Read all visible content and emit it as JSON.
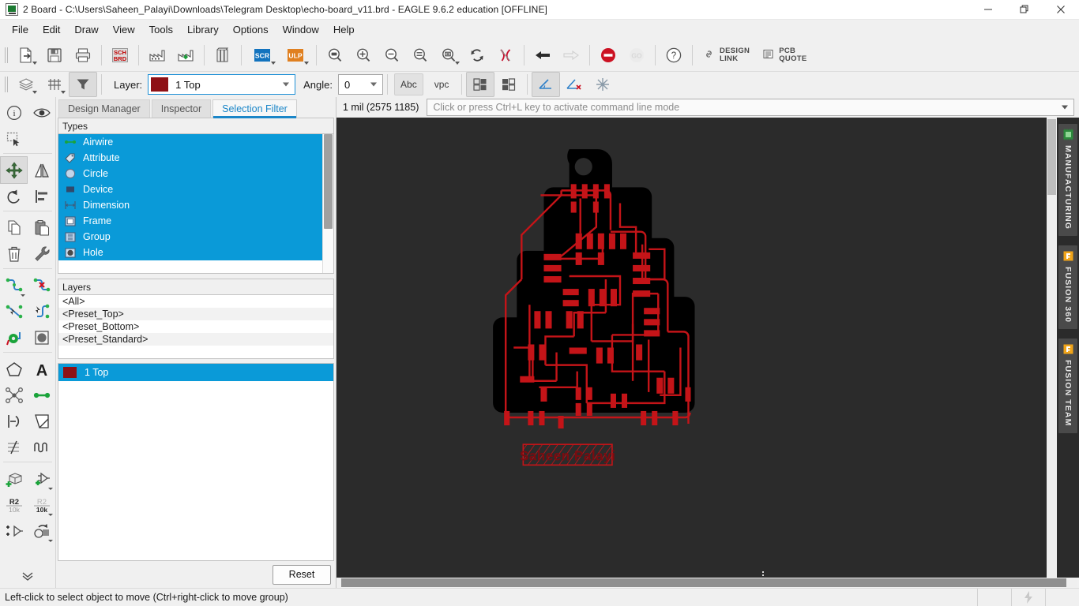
{
  "window": {
    "title": "2 Board - C:\\Users\\Saheen_Palayi\\Downloads\\Telegram Desktop\\echo-board_v11.brd - EAGLE 9.6.2 education [OFFLINE]",
    "app_icon": "board-file-icon",
    "minimize": "minimize-icon",
    "restore": "restore-icon",
    "close": "close-icon"
  },
  "menu": {
    "items": [
      "File",
      "Edit",
      "Draw",
      "View",
      "Tools",
      "Library",
      "Options",
      "Window",
      "Help"
    ]
  },
  "toolbar": {
    "groups": [
      {
        "buttons": [
          {
            "name": "open-file-button",
            "icon": "open-document-icon",
            "dropdown": true,
            "enabled": true
          },
          {
            "name": "save-button",
            "icon": "floppy-save-icon",
            "dropdown": false,
            "enabled": true
          },
          {
            "name": "print-button",
            "icon": "printer-icon",
            "dropdown": false,
            "enabled": true
          }
        ]
      },
      {
        "buttons": [
          {
            "name": "switch-to-schematic-button",
            "icon": "sch-brd-icon",
            "dropdown": false,
            "enabled": true
          }
        ]
      },
      {
        "buttons": [
          {
            "name": "cam-processor-button",
            "icon": "factory-icon",
            "dropdown": false,
            "enabled": true
          },
          {
            "name": "generate-manufacturing-button",
            "icon": "factory-download-icon",
            "dropdown": false,
            "enabled": true
          }
        ]
      },
      {
        "buttons": [
          {
            "name": "library-manager-button",
            "icon": "books-icon",
            "dropdown": false,
            "enabled": true
          }
        ]
      },
      {
        "buttons": [
          {
            "name": "run-script-button",
            "icon": "scr-icon",
            "dropdown": true,
            "enabled": true
          },
          {
            "name": "run-ulp-button",
            "icon": "ulp-icon",
            "dropdown": true,
            "enabled": true
          }
        ]
      },
      {
        "buttons": [
          {
            "name": "zoom-fit-button",
            "icon": "zoom-fit-icon",
            "dropdown": false,
            "enabled": true
          },
          {
            "name": "zoom-in-button",
            "icon": "zoom-in-icon",
            "dropdown": false,
            "enabled": true
          },
          {
            "name": "zoom-out-button",
            "icon": "zoom-out-icon",
            "dropdown": false,
            "enabled": true
          },
          {
            "name": "zoom-select-button",
            "icon": "zoom-select-icon",
            "dropdown": false,
            "enabled": true
          },
          {
            "name": "zoom-region-button",
            "icon": "zoom-region-icon",
            "dropdown": true,
            "enabled": true
          },
          {
            "name": "redraw-button",
            "icon": "refresh-icon",
            "dropdown": false,
            "enabled": true
          },
          {
            "name": "ratsnest-button",
            "icon": "ratsnest-x-icon",
            "dropdown": false,
            "enabled": true
          }
        ]
      },
      {
        "buttons": [
          {
            "name": "undo-button",
            "icon": "undo-arrow-icon",
            "dropdown": false,
            "enabled": true
          },
          {
            "name": "redo-button",
            "icon": "redo-arrow-icon",
            "dropdown": false,
            "enabled": false
          }
        ]
      },
      {
        "buttons": [
          {
            "name": "stop-button",
            "icon": "stop-icon",
            "dropdown": false,
            "enabled": true
          },
          {
            "name": "go-button",
            "icon": "go-icon",
            "dropdown": false,
            "enabled": false
          }
        ]
      },
      {
        "buttons": [
          {
            "name": "help-button",
            "icon": "question-mark-icon",
            "dropdown": false,
            "enabled": true
          }
        ]
      }
    ],
    "design_link": {
      "line1": "DESIGN",
      "line2": "LINK",
      "icon": "link-chain-icon"
    },
    "pcb_quote": {
      "line1": "PCB",
      "line2": "QUOTE",
      "icon": "document-lines-icon"
    }
  },
  "toolbar2": {
    "layer_settings_icon": "layers-stack-icon",
    "grid_icon": "grid-icon",
    "selection_filter_icon": "funnel-filter-icon",
    "layer_label": "Layer:",
    "layer_value": "1 Top",
    "layer_color": "#8e1015",
    "angle_label": "Angle:",
    "angle_value": "0",
    "abc_button": "Abc",
    "vpc_button": "vpc",
    "buttons": [
      {
        "name": "display-all-layers-button",
        "icon": "checkerboard-a-icon"
      },
      {
        "name": "hide-layers-button",
        "icon": "checkerboard-b-icon"
      },
      {
        "name": "angle-snap-on-button",
        "icon": "angle-snap-icon"
      },
      {
        "name": "angle-snap-off-button",
        "icon": "angle-snap-off-icon"
      },
      {
        "name": "snap-point-button",
        "icon": "snap-spark-icon"
      }
    ]
  },
  "left_toolbar": {
    "buttons": [
      {
        "name": "info-tool",
        "icon": "info-circle-icon"
      },
      {
        "name": "show-tool",
        "icon": "eye-icon"
      },
      {
        "name": "group-tool",
        "icon": "marquee-select-icon"
      },
      {
        "name": "move-tool",
        "icon": "move-arrows-icon",
        "active": true
      },
      {
        "name": "mirror-tool",
        "icon": "mirror-icon"
      },
      {
        "name": "rotate-tool",
        "icon": "rotate-ccw-icon"
      },
      {
        "name": "align-tool",
        "icon": "align-left-icon"
      },
      {
        "name": "copy-tool",
        "icon": "copy-pages-icon"
      },
      {
        "name": "paste-tool",
        "icon": "clipboard-paste-icon"
      },
      {
        "name": "delete-tool",
        "icon": "trash-can-icon"
      },
      {
        "name": "change-tool",
        "icon": "wrench-icon"
      },
      {
        "name": "route-tool",
        "icon": "route-wire-icon"
      },
      {
        "name": "ripup-tool",
        "icon": "ripup-wire-icon"
      },
      {
        "name": "autoroute-tool",
        "icon": "autoroute-icon"
      },
      {
        "name": "fanout-tool",
        "icon": "fanout-icon"
      },
      {
        "name": "via-tool",
        "icon": "via-icon"
      },
      {
        "name": "pad-tool",
        "icon": "pad-icon"
      },
      {
        "name": "polygon-tool",
        "icon": "polygon-icon"
      },
      {
        "name": "text-tool",
        "icon": "text-a-icon"
      },
      {
        "name": "ratsnest-tool",
        "icon": "ratsnest-node-icon"
      },
      {
        "name": "wire-tool",
        "icon": "wire-segment-icon"
      },
      {
        "name": "split-tool",
        "icon": "split-arrow-icon"
      },
      {
        "name": "miter-tool",
        "icon": "miter-corner-icon"
      },
      {
        "name": "smash-tool",
        "icon": "smash-lines-icon"
      },
      {
        "name": "meander-tool",
        "icon": "meander-wave-icon"
      },
      {
        "name": "add-package-tool",
        "icon": "add-package-icon"
      },
      {
        "name": "add-part-tool",
        "icon": "add-part-icon"
      },
      {
        "name": "attribute-tool",
        "icon": "r2-10k-icon"
      },
      {
        "name": "value-tool",
        "icon": "r2-10k-bold-icon"
      },
      {
        "name": "add-gate-tool",
        "icon": "add-gate-icon"
      },
      {
        "name": "replace-tool",
        "icon": "replace-icon"
      },
      {
        "name": "more-tools-button",
        "icon": "chevron-double-down-icon"
      }
    ]
  },
  "panel": {
    "tabs": [
      {
        "label": "Design Manager",
        "active": false
      },
      {
        "label": "Inspector",
        "active": false
      },
      {
        "label": "Selection Filter",
        "active": true
      }
    ],
    "types_header": "Types",
    "types": [
      {
        "label": "Airwire",
        "icon": "airwire-icon",
        "selected": true
      },
      {
        "label": "Attribute",
        "icon": "attribute-tag-icon",
        "selected": true
      },
      {
        "label": "Circle",
        "icon": "circle-icon",
        "selected": true
      },
      {
        "label": "Device",
        "icon": "device-chip-icon",
        "selected": true
      },
      {
        "label": "Dimension",
        "icon": "dimension-icon",
        "selected": true
      },
      {
        "label": "Frame",
        "icon": "frame-icon",
        "selected": true
      },
      {
        "label": "Group",
        "icon": "group-icon",
        "selected": true
      },
      {
        "label": "Hole",
        "icon": "hole-icon",
        "selected": true
      }
    ],
    "layers_header": "Layers",
    "presets": [
      "<All>",
      "<Preset_Top>",
      "<Preset_Bottom>",
      "<Preset_Standard>"
    ],
    "layer_rows": [
      {
        "label": "1 Top",
        "color": "#8e1015",
        "selected": true
      }
    ],
    "reset_button": "Reset"
  },
  "command_bar": {
    "coords": "1 mil (2575 1185)",
    "placeholder": "Click or press Ctrl+L key to activate command line mode"
  },
  "right_dock": {
    "tabs": [
      {
        "label": "MANUFACTURING",
        "icon": "manufacturing-chip-icon",
        "color": "#2c8a3c"
      },
      {
        "label": "FUSION 360",
        "icon": "fusion-f-icon",
        "color": "#f0a419"
      },
      {
        "label": "FUSION TEAM",
        "icon": "fusion-f-icon",
        "color": "#f0a419"
      }
    ]
  },
  "canvas": {
    "background": "#2b2b2b",
    "board_silhouette_color": "#000000",
    "trace_color": "#c41418",
    "board_text": "Saheen Palayi",
    "cursor": "crosshair-cursor"
  },
  "status_bar": {
    "message": "Left-click to select object to move (Ctrl+right-click to move group)",
    "right_icon": "lightning-bolt-icon"
  }
}
